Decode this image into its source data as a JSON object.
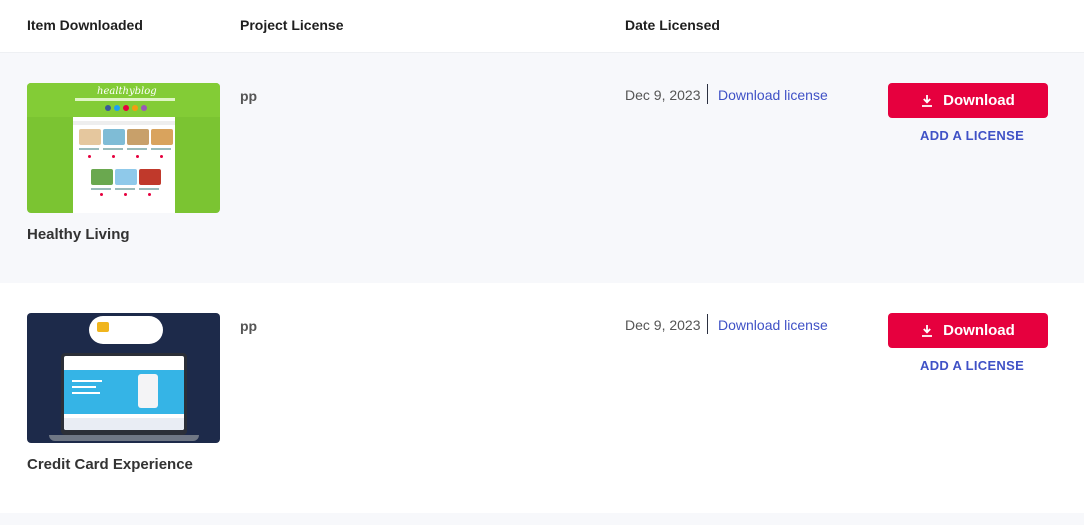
{
  "columns": {
    "item": "Item Downloaded",
    "project": "Project License",
    "date": "Date Licensed"
  },
  "items": [
    {
      "title": "Healthy Living",
      "project": "pp",
      "date": "Dec 9, 2023",
      "download_license": "Download license",
      "download_button": "Download",
      "add_license": "ADD A LICENSE",
      "thumbnail": {
        "logo": "healthyblog"
      }
    },
    {
      "title": "Credit Card Experience",
      "project": "pp",
      "date": "Dec 9, 2023",
      "download_license": "Download license",
      "download_button": "Download",
      "add_license": "ADD A LICENSE",
      "thumbnail": {
        "title_line1": "Credit Card",
        "title_line2": "Experience"
      }
    }
  ],
  "colors": {
    "accent": "#e6003e",
    "link": "#3f51c6"
  },
  "icons": {
    "download_button_icon": "download-icon"
  }
}
